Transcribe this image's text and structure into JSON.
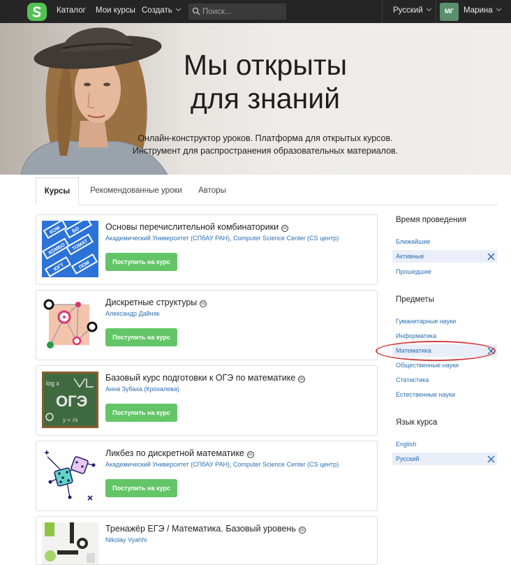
{
  "nav": {
    "catalog": "Каталог",
    "my_courses": "Мои курсы",
    "create": "Создать",
    "search_placeholder": "Поиск...",
    "language": "Русский",
    "avatar_initials": "МГ",
    "user_name": "Марина"
  },
  "hero": {
    "title_line1": "Мы открыты",
    "title_line2": "для знаний",
    "subtitle_line1": "Онлайн-конструктор уроков. Платформа для открытых курсов.",
    "subtitle_line2": "Инструмент для распространения образовательных материалов."
  },
  "tabs": [
    {
      "label": "Курсы",
      "active": true
    },
    {
      "label": "Рекомендованные уроки",
      "active": false
    },
    {
      "label": "Авторы",
      "active": false
    }
  ],
  "courses": [
    {
      "title": "Основы перечислительной комбинаторики",
      "author": "Академический Университет (СПбАУ РАН), Computer Science Center (CS центр)",
      "button": "Поступить на курс"
    },
    {
      "title": "Дискретные структуры",
      "author": "Александр Дайняк",
      "button": "Поступить на курс"
    },
    {
      "title": "Базовый курс подготовки к ОГЭ по математике",
      "author": "Анна Зубаха (Крохалева)",
      "button": "Поступить на курс"
    },
    {
      "title": "Ликбез по дискретной математике",
      "author": "Академический Университет (СПбАУ РАН), Computer Science Center (CS центр)",
      "button": "Поступить на курс"
    },
    {
      "title": "Тренажёр ЕГЭ / Математика. Базовый уровень",
      "author": "Nikolay Vyahhi",
      "button": "Поступить на курс"
    }
  ],
  "cc_glyph": "cc",
  "thumb_texts": {
    "t1_words": [
      "КОМ",
      "БО",
      "КОМБО",
      "ТОМАТ",
      "ЮГТ",
      "ПОМ"
    ],
    "t3_words": [
      "log x",
      "ОГЭ",
      "y = √x"
    ]
  },
  "filters": {
    "time": {
      "heading": "Время проведения",
      "items": [
        "Ближайшие",
        "Активные",
        "Прошедшие"
      ],
      "selected": "Активные"
    },
    "subjects": {
      "heading": "Предметы",
      "items": [
        "Гуманитарные науки",
        "Информатика",
        "Математика",
        "Общественные науки",
        "Статистика",
        "Естественные науки"
      ],
      "selected": "Математика"
    },
    "language": {
      "heading": "Язык курса",
      "items": [
        "English",
        "Русский"
      ],
      "selected": "Русский"
    }
  },
  "colors": {
    "accent_green": "#63c567",
    "link_blue": "#2a6fb0",
    "nav_bg": "#252525",
    "annotation_red": "#d24040"
  },
  "icons": [
    "stepik-logo-icon",
    "search-icon",
    "chevron-down-icon",
    "close-icon",
    "creative-commons-icon"
  ]
}
